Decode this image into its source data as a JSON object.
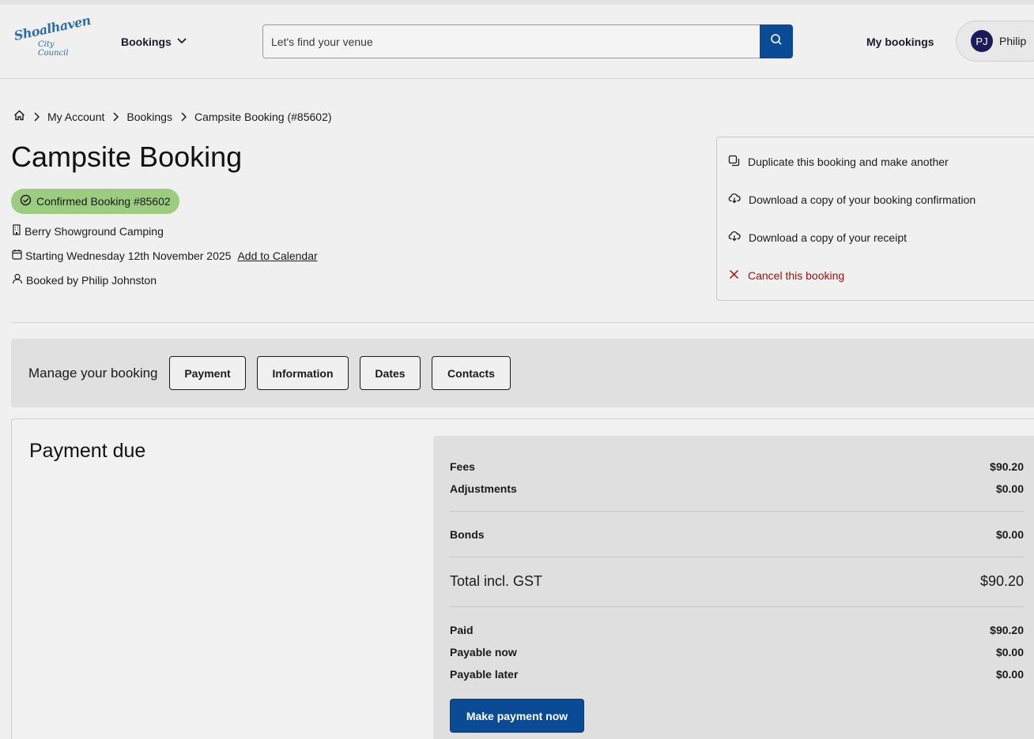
{
  "header": {
    "logo_line1": "Shoalhaven",
    "logo_line2": "City Council",
    "bookings_menu": "Bookings",
    "search_placeholder": "Let's find your venue",
    "my_bookings": "My bookings",
    "user_initials": "PJ",
    "user_name": "Philip"
  },
  "breadcrumb": {
    "items": [
      "My Account",
      "Bookings",
      "Campsite Booking (#85602)"
    ]
  },
  "booking": {
    "title": "Campsite Booking",
    "status_badge": "Confirmed Booking #85602",
    "venue": "Berry Showground Camping",
    "start": "Starting Wednesday 12th November 2025",
    "add_to_calendar": "Add to Calendar",
    "booked_by": "Booked by Philip Johnston"
  },
  "actions": {
    "duplicate": "Duplicate this booking and make another",
    "download_confirmation": "Download a copy of your booking confirmation",
    "download_receipt": "Download a copy of your receipt",
    "cancel": "Cancel this booking"
  },
  "manage": {
    "label": "Manage your booking",
    "buttons": [
      "Payment",
      "Information",
      "Dates",
      "Contacts"
    ]
  },
  "payment": {
    "heading": "Payment due",
    "fees_label": "Fees",
    "fees": "$90.20",
    "adjustments_label": "Adjustments",
    "adjustments": "$0.00",
    "bonds_label": "Bonds",
    "bonds": "$0.00",
    "total_label": "Total incl. GST",
    "total": "$90.20",
    "paid_label": "Paid",
    "paid": "$90.20",
    "payable_now_label": "Payable now",
    "payable_now": "$0.00",
    "payable_later_label": "Payable later",
    "payable_later": "$0.00",
    "pay_button": "Make payment now"
  },
  "colors": {
    "primary": "#0b4a94",
    "badge": "#9ccc80",
    "cancel": "#a30d0d",
    "avatar": "#1d1a5c"
  }
}
